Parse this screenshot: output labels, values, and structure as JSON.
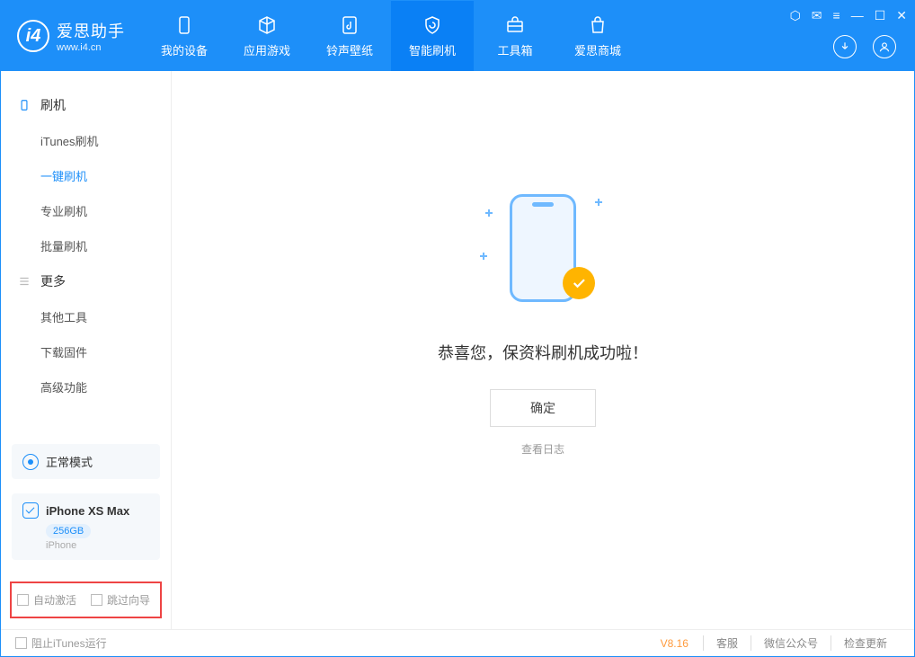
{
  "app": {
    "name": "爱思助手",
    "url": "www.i4.cn"
  },
  "nav": {
    "my_device": "我的设备",
    "apps_games": "应用游戏",
    "ring_wall": "铃声壁纸",
    "smart_flash": "智能刷机",
    "toolbox": "工具箱",
    "store": "爱思商城"
  },
  "sidebar": {
    "group_flash": "刷机",
    "items": {
      "itunes_flash": "iTunes刷机",
      "one_key_flash": "一键刷机",
      "pro_flash": "专业刷机",
      "batch_flash": "批量刷机"
    },
    "group_more": "更多",
    "more_items": {
      "other_tools": "其他工具",
      "download_fw": "下载固件",
      "advanced": "高级功能"
    }
  },
  "mode": {
    "label": "正常模式"
  },
  "device": {
    "name": "iPhone XS Max",
    "capacity": "256GB",
    "type": "iPhone"
  },
  "checks": {
    "auto_activate": "自动激活",
    "skip_guide": "跳过向导"
  },
  "main": {
    "success_msg": "恭喜您，保资料刷机成功啦！",
    "ok": "确定",
    "view_log": "查看日志"
  },
  "footer": {
    "block_itunes": "阻止iTunes运行",
    "version": "V8.16",
    "service": "客服",
    "wechat": "微信公众号",
    "check_update": "检查更新"
  }
}
